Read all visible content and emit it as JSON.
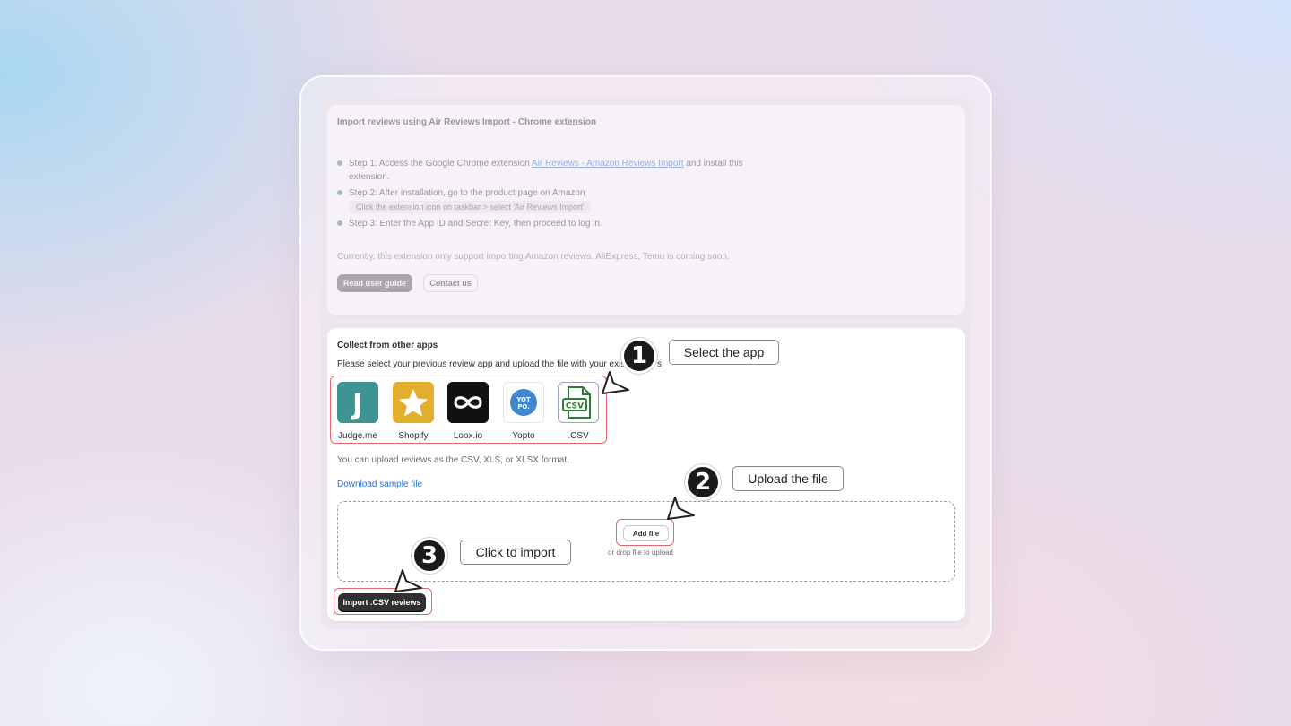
{
  "extension_card": {
    "title": "Import reviews using Air Reviews Import - Chrome extension",
    "step1_prefix": "Step 1: Access the Google Chrome extension ",
    "step1_link": "Air Reviews - Amazon Reviews Import",
    "step1_suffix": " and install this",
    "step1_cont": "extension.",
    "step2": "Step 2: After installation, go to the product page on Amazon",
    "step2_hint": "Click the extension icon on taskbar > select 'Air Reviews Import'",
    "step3": "Step 3: Enter the App ID and Secret Key, then proceed to log in.",
    "note": "Currently, this extension only support importing Amazon reviews. AliExpress, Temu is coming soon.",
    "guide_button": "Read user guide",
    "contact_button": "Contact us"
  },
  "collect_card": {
    "title": "Collect from other apps",
    "subtitle_visible": "Please select your previous review app and upload the file with your existi",
    "subtitle_tail": "s",
    "apps": [
      {
        "label": "Judge.me",
        "icon": "judgeme-icon"
      },
      {
        "label": "Shopify",
        "icon": "shopify-star-icon"
      },
      {
        "label": "Loox.io",
        "icon": "loox-infinity-icon"
      },
      {
        "label": "Yopto",
        "icon": "yotpo-icon",
        "badge": "YOT PO."
      },
      {
        "label": ".CSV",
        "icon": "csv-file-icon",
        "badge": "CSV"
      }
    ],
    "format_note": "You can upload reviews as the CSV, XLS, or XLSX format.",
    "sample_link": "Download sample file",
    "add_file_button": "Add file",
    "drop_hint": "or drop file to upload",
    "import_button": "Import .CSV reviews"
  },
  "annotations": [
    {
      "number": "1",
      "label": "Select the app"
    },
    {
      "number": "2",
      "label": "Upload the file"
    },
    {
      "number": "3",
      "label": "Click to import"
    }
  ],
  "colors": {
    "accent_link": "#2c6ecb",
    "highlight_red": "#e8646b",
    "primary_button": "#303030"
  }
}
